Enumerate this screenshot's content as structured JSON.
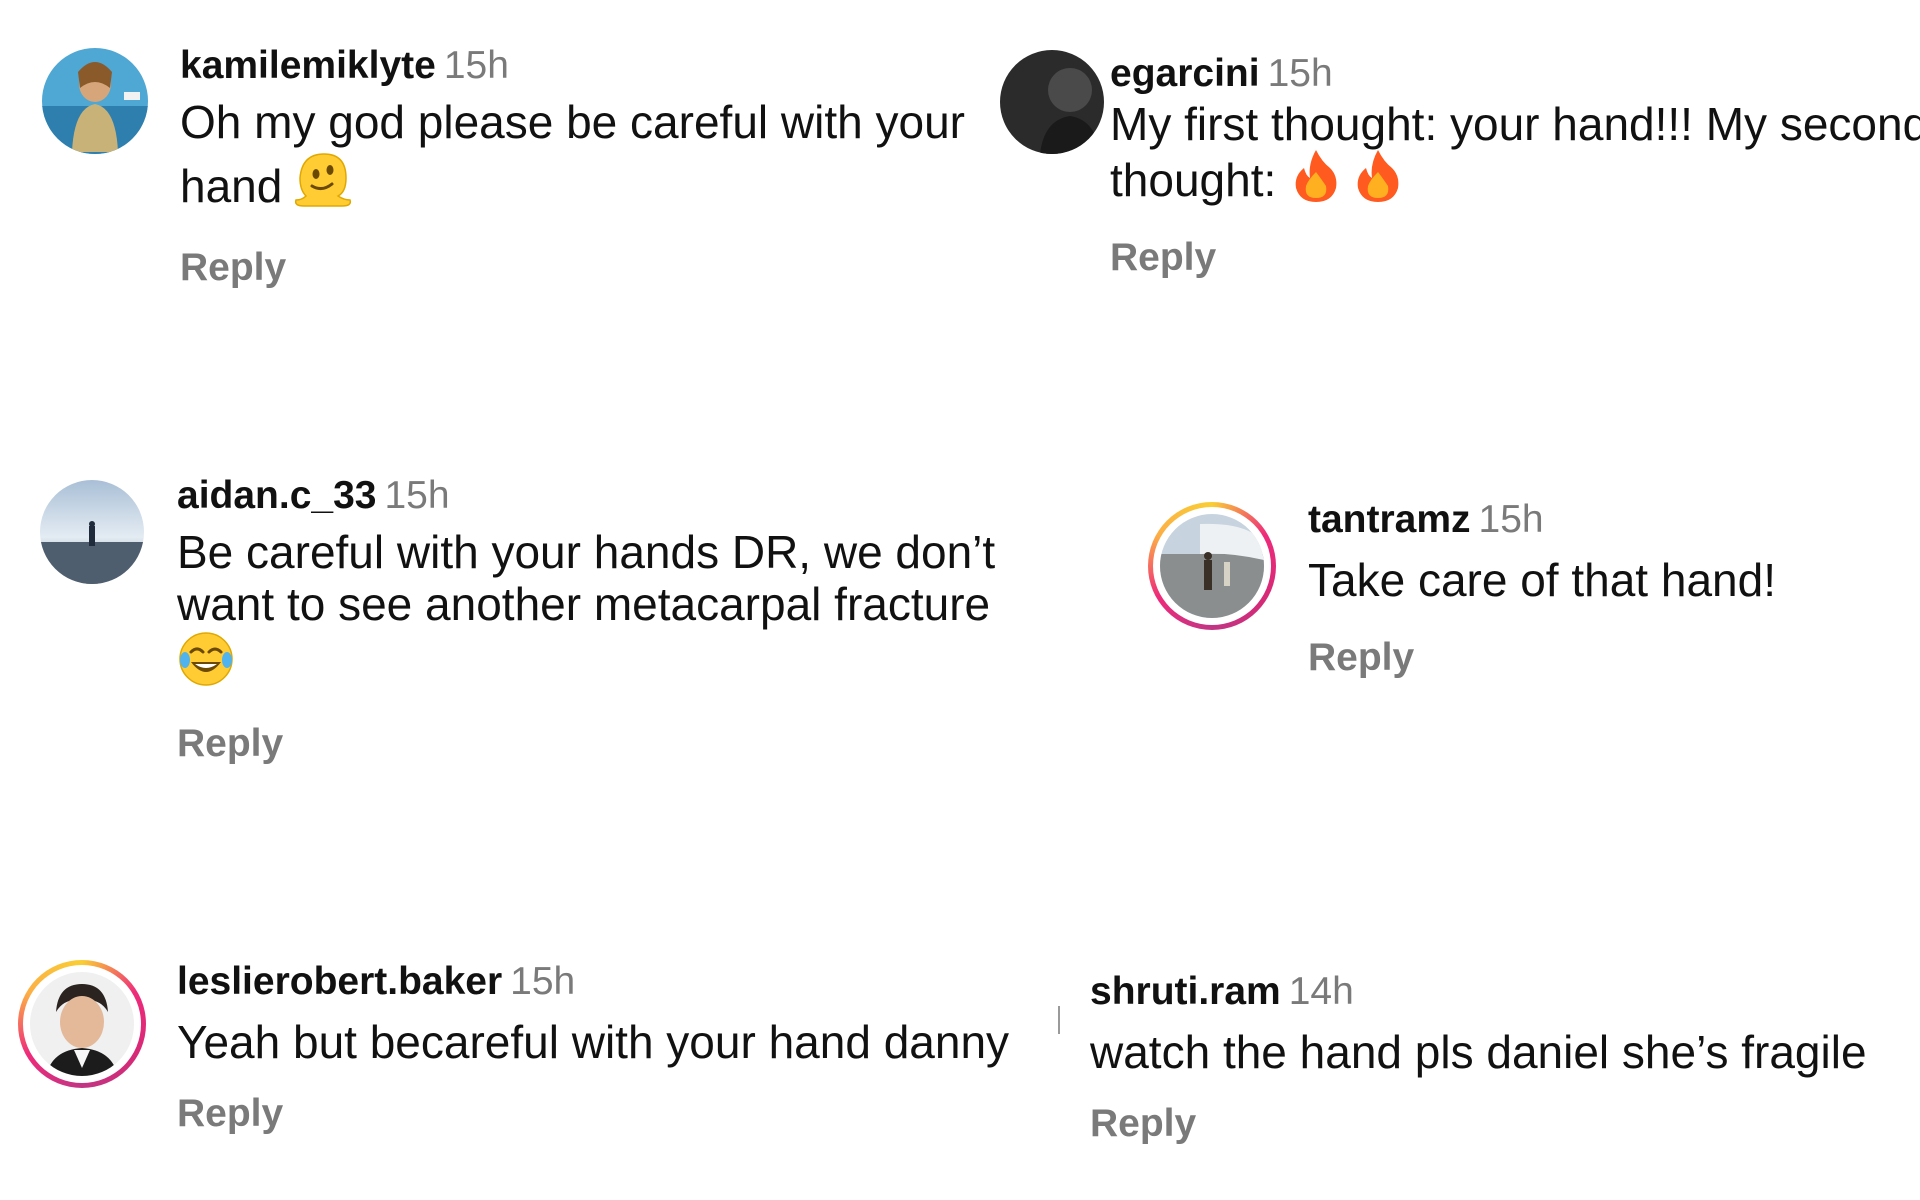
{
  "comments": [
    {
      "username": "kamilemiklyte",
      "time": "15h",
      "text_line1": "Oh my god please be careful with your",
      "text_line2": "hand",
      "reply": "Reply",
      "emoji": "melting-face"
    },
    {
      "username": "egarcini",
      "time": "15h",
      "text_line1": "My first thought: your hand!!! My second",
      "text_line2": "thought:",
      "reply": "Reply",
      "emoji": "fire"
    },
    {
      "username": "aidan.c_33",
      "time": "15h",
      "text_line1": "Be careful with your hands DR, we don’t",
      "text_line2": "want to see another metacarpal fracture",
      "reply": "Reply",
      "emoji": "tears-of-joy"
    },
    {
      "username": "tantramz",
      "time": "15h",
      "text_line1": "Take care of that hand!",
      "reply": "Reply"
    },
    {
      "username": "leslierobert.baker",
      "time": "15h",
      "text_line1": "Yeah but becareful with your hand danny",
      "reply": "Reply"
    },
    {
      "username": "shruti.ram",
      "time": "14h",
      "text_line1": "watch the hand pls daniel she’s fragile",
      "reply": "Reply"
    }
  ],
  "colors": {
    "username": "#111111",
    "timestamp": "#7a7a7a",
    "reply": "#7a7a7a",
    "story_ring_start": "#f9ce34",
    "story_ring_mid": "#ee2a7b",
    "story_ring_end": "#c13584"
  }
}
